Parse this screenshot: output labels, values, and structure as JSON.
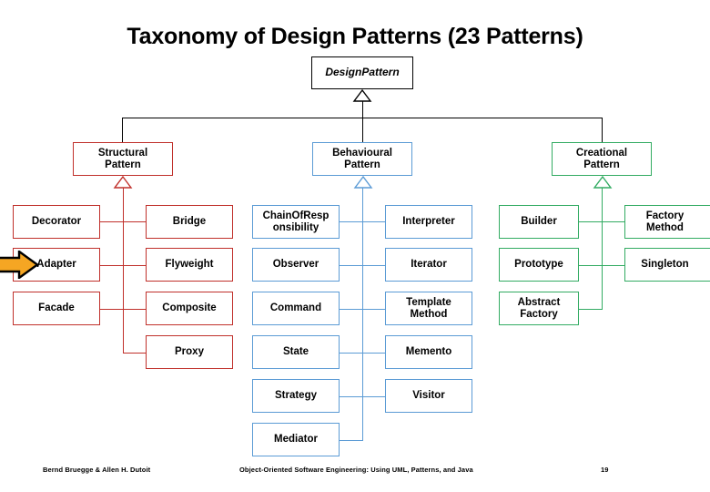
{
  "slide": {
    "title": "Taxonomy of Design Patterns (23 Patterns)",
    "colors": {
      "root": "#000000",
      "structural": "#c0302b",
      "behavioural": "#5b9bd5",
      "creational": "#32ab62",
      "pointer": "#f5a623",
      "background": "#ffffff"
    }
  },
  "root": {
    "label": "DesignPattern"
  },
  "categories": {
    "structural": {
      "label": "Structural\nPattern",
      "line1": "Structural",
      "line2": "Pattern"
    },
    "behavioural": {
      "label": "Behavioural\nPattern",
      "line1": "Behavioural",
      "line2": "Pattern"
    },
    "creational": {
      "label": "Creational\nPattern",
      "line1": "Creational",
      "line2": "Pattern"
    }
  },
  "structural_patterns": [
    {
      "label": "Decorator"
    },
    {
      "label": "Bridge"
    },
    {
      "label": "Adapter",
      "highlighted": true
    },
    {
      "label": "Flyweight"
    },
    {
      "label": "Facade"
    },
    {
      "label": "Composite"
    },
    {
      "label": "Proxy"
    }
  ],
  "behavioural_patterns": [
    {
      "label": "ChainOfResponsibility",
      "line1": "ChainOfResp",
      "line2": "onsibility"
    },
    {
      "label": "Interpreter"
    },
    {
      "label": "Observer"
    },
    {
      "label": "Iterator"
    },
    {
      "label": "Command"
    },
    {
      "label": "Template Method",
      "line1": "Template",
      "line2": "Method"
    },
    {
      "label": "State"
    },
    {
      "label": "Memento"
    },
    {
      "label": "Strategy"
    },
    {
      "label": "Visitor"
    },
    {
      "label": "Mediator"
    }
  ],
  "creational_patterns": [
    {
      "label": "Builder"
    },
    {
      "label": "Factory Method",
      "line1": "Factory",
      "line2": "Method"
    },
    {
      "label": "Prototype"
    },
    {
      "label": "Singleton"
    },
    {
      "label": "Abstract Factory",
      "line1": "Abstract",
      "line2": "Factory"
    }
  ],
  "pointer": {
    "icon": "right-arrow-icon",
    "points_at": "Adapter"
  },
  "footer": {
    "author": "Bernd Bruegge & Allen H. Dutoit",
    "book": "Object-Oriented Software Engineering: Using UML, Patterns, and Java",
    "page": "19"
  }
}
